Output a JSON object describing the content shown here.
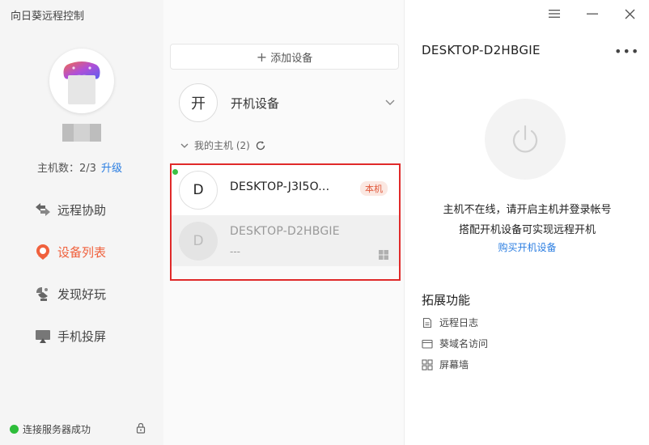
{
  "app": {
    "title": "向日葵远程控制"
  },
  "sidebar": {
    "host_count_label": "主机数：2/3",
    "upgrade_label": "升级",
    "items": [
      {
        "label": "远程协助",
        "icon": "remote-assist-icon"
      },
      {
        "label": "设备列表",
        "icon": "device-list-icon",
        "active": true
      },
      {
        "label": "发现好玩",
        "icon": "discover-icon"
      },
      {
        "label": "手机投屏",
        "icon": "screen-cast-icon"
      }
    ],
    "status_text": "连接服务器成功"
  },
  "middle": {
    "add_device_label": "添加设备",
    "power_device": {
      "avatar_char": "开",
      "label": "开机设备"
    },
    "group_label": "我的主机 (2)",
    "devices": [
      {
        "avatar_char": "D",
        "name": "DESKTOP-J3I5O...",
        "badge": "本机",
        "online": true
      },
      {
        "avatar_char": "D",
        "name": "DESKTOP-D2HBGIE",
        "sub": "---",
        "online": false,
        "os": "windows"
      }
    ]
  },
  "detail": {
    "device_name": "DESKTOP-D2HBGIE",
    "more_label": "•••",
    "offline_line1": "主机不在线，请开启主机并登录帐号",
    "offline_line2": "搭配开机设备可实现远程开机",
    "buy_link": "购买开机设备",
    "ext_title": "拓展功能",
    "ext_items": [
      {
        "label": "远程日志",
        "icon": "log-icon"
      },
      {
        "label": "葵域名访问",
        "icon": "domain-icon"
      },
      {
        "label": "屏幕墙",
        "icon": "grid-icon"
      }
    ]
  },
  "colors": {
    "accent": "#f0613d",
    "link": "#2a7de1",
    "online": "#2ebd3a",
    "highlight": "#e02a2a"
  }
}
